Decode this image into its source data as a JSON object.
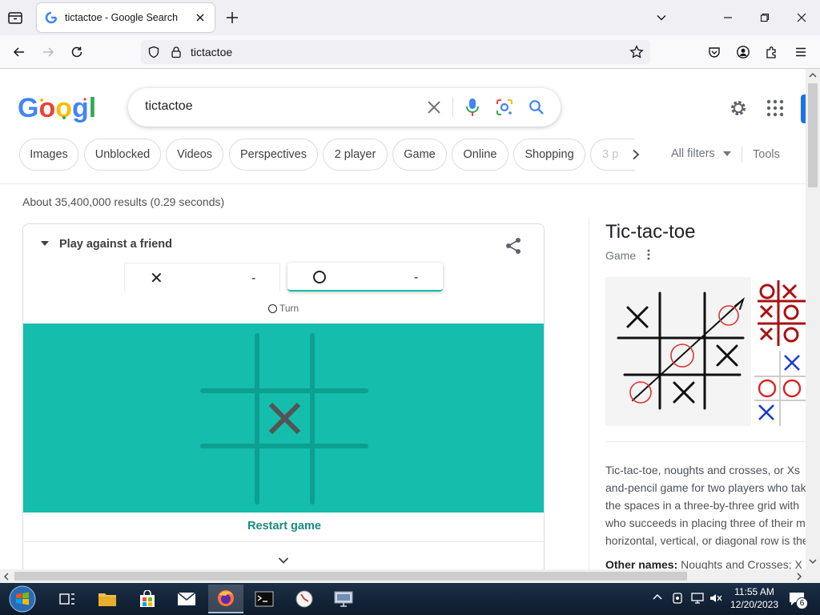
{
  "browser": {
    "tab_title": "tictactoe - Google Search",
    "url": "tictactoe"
  },
  "search": {
    "query": "tictactoe"
  },
  "filters": {
    "chips": [
      "Images",
      "Unblocked",
      "Videos",
      "Perspectives",
      "2 player",
      "Game",
      "Online",
      "Shopping",
      "3 p"
    ],
    "all_filters": "All filters",
    "tools": "Tools"
  },
  "results_count": "About 35,400,000 results (0.29 seconds)",
  "game": {
    "mode": "Play against a friend",
    "player_x_symbol": "✕",
    "player_x_score": "-",
    "player_o_symbol": "O",
    "player_o_score": "-",
    "turn_label": "Turn",
    "board": [
      "",
      "",
      "",
      "",
      "X",
      "",
      "",
      "",
      ""
    ],
    "restart": "Restart game",
    "board_color": "#14bdac"
  },
  "knowledge_panel": {
    "title": "Tic-tac-toe",
    "subtitle": "Game",
    "description_lines": [
      "Tic-tac-toe, noughts and crosses, or Xs",
      "and-pencil game for two players who tak",
      "the spaces in a three-by-three grid with",
      "who succeeds in placing three of their m",
      "horizontal, vertical, or diagonal row is the"
    ],
    "other_names_label": "Other names:",
    "other_names_value": "Noughts and Crosses; X"
  },
  "taskbar": {
    "time": "11:55 AM",
    "date": "12/20/2023",
    "notification_count": "6"
  }
}
